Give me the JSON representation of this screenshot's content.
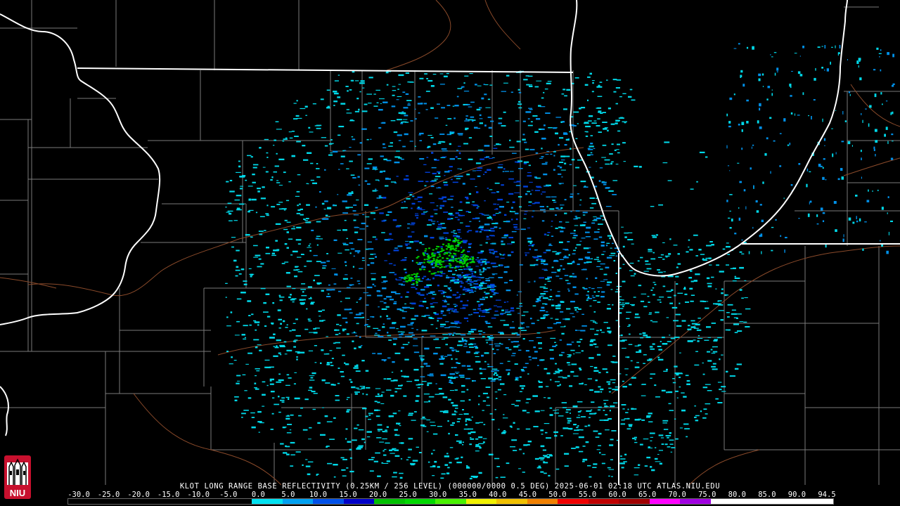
{
  "product_title": "KLOT LONG RANGE BASE REFLECTIVITY (0.25KM / 256 LEVEL) (000000/0000 0.5 DEG) 2025-06-01 02:18 UTC  ATLAS.NIU.EDU",
  "logo_text": "NIU",
  "colorbar": {
    "labels": [
      "-30.0",
      "-25.0",
      "-20.0",
      "-15.0",
      "-10.0",
      "-5.0",
      "0.0",
      "5.0",
      "10.0",
      "15.0",
      "20.0",
      "25.0",
      "30.0",
      "35.0",
      "40.0",
      "45.0",
      "50.0",
      "55.0",
      "60.0",
      "65.0",
      "70.0",
      "75.0",
      "80.0",
      "85.0",
      "90.0",
      "94.5"
    ],
    "colors": [
      "#000000",
      "#000000",
      "#000000",
      "#000000",
      "#000000",
      "#000000",
      "#00e0f0",
      "#00a0f0",
      "#0050e8",
      "#0000c8",
      "#00c000",
      "#00d800",
      "#48f000",
      "#f0f000",
      "#f0c000",
      "#f08000",
      "#f00000",
      "#c00000",
      "#a00000",
      "#ff00ff",
      "#a000e0",
      "#ffffff",
      "#ffffff",
      "#ffffff",
      "#ffffff"
    ]
  },
  "map_colors": {
    "state_border": "#ffffff",
    "county_border": "#7a7a7a",
    "river": "#8a4a2a",
    "echo_light": "#00d8e8",
    "echo_mid": "#0090e8",
    "echo_heavy": "#0040d8",
    "echo_green": "#00d000"
  }
}
